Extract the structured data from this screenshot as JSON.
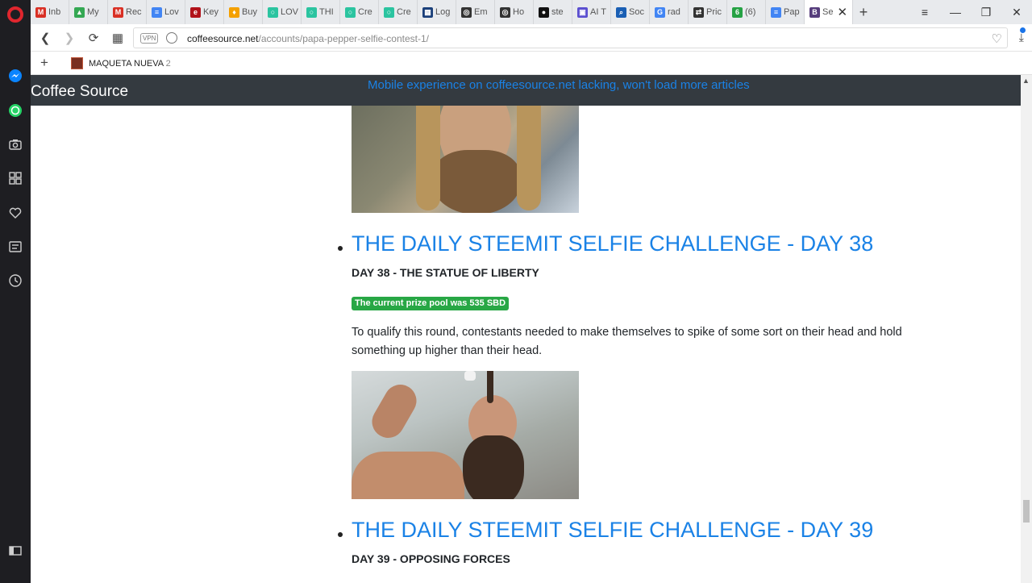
{
  "tabs": [
    {
      "label": "Inb",
      "icon": "gmail-icon",
      "color": "#d93025",
      "glyph": "M"
    },
    {
      "label": "My",
      "icon": "drive-icon",
      "color": "#34a853",
      "glyph": "▲"
    },
    {
      "label": "Rec",
      "icon": "gmail-icon",
      "color": "#d93025",
      "glyph": "M"
    },
    {
      "label": "Lov",
      "icon": "docs-icon",
      "color": "#4285f4",
      "glyph": "≡"
    },
    {
      "label": "Key",
      "icon": "edx-icon",
      "color": "#b1121a",
      "glyph": "e"
    },
    {
      "label": "Buy",
      "icon": "flame-icon",
      "color": "#f4a000",
      "glyph": "♦"
    },
    {
      "label": "LOV",
      "icon": "circle-icon",
      "color": "#2bc4a0",
      "glyph": "○"
    },
    {
      "label": "THI",
      "icon": "circle-icon",
      "color": "#2bc4a0",
      "glyph": "○"
    },
    {
      "label": "Cre",
      "icon": "circle-icon",
      "color": "#2bc4a0",
      "glyph": "○"
    },
    {
      "label": "Cre",
      "icon": "circle-icon",
      "color": "#2bc4a0",
      "glyph": "○"
    },
    {
      "label": "Log",
      "icon": "grid-icon",
      "color": "#1a3f7a",
      "glyph": "▦"
    },
    {
      "label": "Em",
      "icon": "target-icon",
      "color": "#333333",
      "glyph": "◎"
    },
    {
      "label": "Ho",
      "icon": "target-icon",
      "color": "#333333",
      "glyph": "◎"
    },
    {
      "label": "ste",
      "icon": "github-icon",
      "color": "#111111",
      "glyph": "●"
    },
    {
      "label": "AI T",
      "icon": "app-icon",
      "color": "#5b4fd0",
      "glyph": "▣"
    },
    {
      "label": "Soc",
      "icon": "search-icon",
      "color": "#1a5fb4",
      "glyph": "⌕"
    },
    {
      "label": "rad",
      "icon": "google-icon",
      "color": "#4285f4",
      "glyph": "G"
    },
    {
      "label": "Pric",
      "icon": "car-icon",
      "color": "#333333",
      "glyph": "⇄"
    },
    {
      "label": "(6)",
      "icon": "green-badge-icon",
      "color": "#25a244",
      "glyph": "6"
    },
    {
      "label": "Pap",
      "icon": "docs-icon",
      "color": "#4285f4",
      "glyph": "≡"
    },
    {
      "label": "Se",
      "icon": "bootstrap-icon",
      "color": "#563d7c",
      "glyph": "B",
      "active": true
    }
  ],
  "address": {
    "vpn_label": "VPN",
    "domain": "coffeesource.net",
    "path": "/accounts/papa-pepper-selfie-contest-1/"
  },
  "bookmarks": [
    {
      "label": "MAQUETA NUEVA",
      "count": "2"
    }
  ],
  "site": {
    "brand": "Coffee Source",
    "notice": "Mobile experience on coffeesource.net lacking, won't load more articles"
  },
  "posts": [
    {
      "title": "THE DAILY STEEMIT SELFIE CHALLENGE - DAY 38",
      "subtitle": "DAY 38 - THE STATUE OF LIBERTY",
      "badge": "The current prize pool was 535 SBD",
      "description": "To qualify this round, contestants needed to make themselves to spike of some sort on their head and hold something up higher than their head."
    },
    {
      "title": "THE DAILY STEEMIT SELFIE CHALLENGE - DAY 39",
      "subtitle": "DAY 39 - OPPOSING FORCES"
    }
  ],
  "colors": {
    "accent_link": "#1a82e6",
    "header_bg": "#343a40",
    "badge_green": "#28a745",
    "opera_red": "#e0262e"
  }
}
